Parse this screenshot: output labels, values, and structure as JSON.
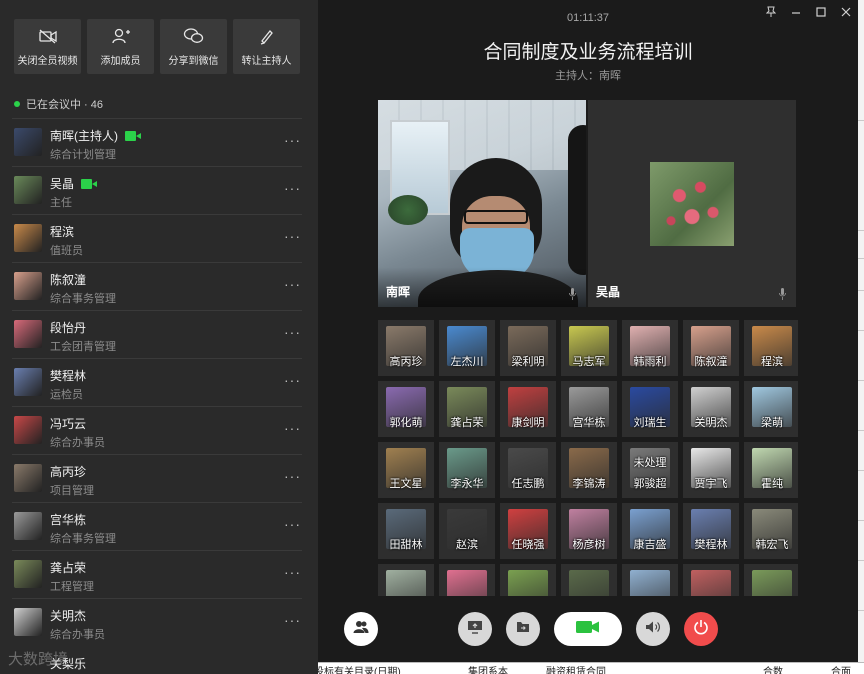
{
  "left_panel": {
    "actions": [
      {
        "label": "关闭全员视频",
        "icon": "video-off-icon"
      },
      {
        "label": "添加成员",
        "icon": "add-user-icon"
      },
      {
        "label": "分享到微信",
        "icon": "wechat-icon"
      },
      {
        "label": "转让主持人",
        "icon": "pen-icon"
      }
    ],
    "in_meeting_text": "已在会议中 · 46",
    "participants": [
      {
        "name": "南晖(主持人)",
        "role": "综合计划管理",
        "camera": true,
        "color": "#3b4a6b"
      },
      {
        "name": "吴晶",
        "role": "主任",
        "camera": true,
        "color": "#6a8a5a"
      },
      {
        "name": "程滨",
        "role": "值班员",
        "camera": false,
        "color": "#c98a4a"
      },
      {
        "name": "陈叙潼",
        "role": "综合事务管理",
        "camera": false,
        "color": "#d7a08c"
      },
      {
        "name": "段怡丹",
        "role": "工会团青管理",
        "camera": false,
        "color": "#d86a7a"
      },
      {
        "name": "樊程林",
        "role": "运检员",
        "camera": false,
        "color": "#6a7fb0"
      },
      {
        "name": "冯巧云",
        "role": "综合办事员",
        "camera": false,
        "color": "#c84848"
      },
      {
        "name": "高丙珍",
        "role": "项目管理",
        "camera": false,
        "color": "#8a7a6a"
      },
      {
        "name": "宫华栋",
        "role": "综合事务管理",
        "camera": false,
        "color": "#9a9a9a"
      },
      {
        "name": "龚占荣",
        "role": "工程管理",
        "camera": false,
        "color": "#7a8a5a"
      },
      {
        "name": "关明杰",
        "role": "综合办事员",
        "camera": false,
        "color": "#d0d0d0"
      }
    ],
    "partial_name": "关梨乐",
    "watermark": "大数跨境"
  },
  "meeting": {
    "timer": "01:11:37",
    "title": "合同制度及业务流程培训",
    "host": "主持人：南晖",
    "window_controls": [
      "pin-icon",
      "minimize-icon",
      "maximize-icon",
      "close-icon"
    ]
  },
  "video_tiles": [
    {
      "name": "南晖"
    },
    {
      "name": "吴晶"
    }
  ],
  "grid": [
    {
      "name": "高丙珍",
      "color": "#8a7a6a"
    },
    {
      "name": "左杰川",
      "color": "#4a8ad0"
    },
    {
      "name": "梁利明",
      "color": "#7a6a5a"
    },
    {
      "name": "马志军",
      "color": "#c8c850"
    },
    {
      "name": "韩雨利",
      "color": "#e0b0b0"
    },
    {
      "name": "陈叙潼",
      "color": "#d7a08c"
    },
    {
      "name": "程滨",
      "color": "#c98a4a"
    },
    {
      "name": "郭化萌",
      "color": "#8a6ab0"
    },
    {
      "name": "龚占荣",
      "color": "#7a8a5a"
    },
    {
      "name": "康剑明",
      "color": "#c04040"
    },
    {
      "name": "宫华栋",
      "color": "#9a9a9a"
    },
    {
      "name": "刘瑞生",
      "color": "#2a4aa0"
    },
    {
      "name": "关明杰",
      "color": "#d0d0d0"
    },
    {
      "name": "梁萌",
      "color": "#a0c8e0"
    },
    {
      "name": "王文星",
      "color": "#a08050"
    },
    {
      "name": "李永华",
      "color": "#6a9a8a"
    },
    {
      "name": "任志鹏",
      "color": "#4a4a4a"
    },
    {
      "name": "李锦涛",
      "color": "#8a6a4a"
    },
    {
      "name": "郭骏超",
      "color": "#7a7a7a",
      "status": "未处理"
    },
    {
      "name": "贾宇飞",
      "color": "#e8e8e8"
    },
    {
      "name": "霍纯",
      "color": "#c0d8b0"
    },
    {
      "name": "田甜林",
      "color": "#5a6a7a"
    },
    {
      "name": "赵滨",
      "color": "#3a3a3a"
    },
    {
      "name": "任晓强",
      "color": "#d04040"
    },
    {
      "name": "杨彦树",
      "color": "#c080a0"
    },
    {
      "name": "康吉盛",
      "color": "#7aa0d0"
    },
    {
      "name": "樊程林",
      "color": "#6a7fb0"
    },
    {
      "name": "韩宏飞",
      "color": "#8a8a7a"
    },
    {
      "name": "",
      "color": "#a0b0a0"
    },
    {
      "name": "",
      "color": "#e07090"
    },
    {
      "name": "",
      "color": "#7aa050"
    },
    {
      "name": "",
      "color": "#5a6a4a"
    },
    {
      "name": "",
      "color": "#90b0d0"
    },
    {
      "name": "",
      "color": "#c06060"
    },
    {
      "name": "",
      "color": "#7a9a5a"
    }
  ],
  "controls": [
    {
      "name": "members-button",
      "icon": "members-icon"
    },
    {
      "name": "share-screen-button",
      "icon": "share-screen-icon"
    },
    {
      "name": "share-file-button",
      "icon": "file-icon"
    },
    {
      "name": "video-button",
      "icon": "camera-icon",
      "color": "#2bc23f"
    },
    {
      "name": "speaker-button",
      "icon": "speaker-icon"
    },
    {
      "name": "hangup-button",
      "icon": "power-icon",
      "color": "#f14c4c"
    }
  ],
  "background_strip": [
    "投标有关目录(日期)",
    "集团系本",
    "融资租赁合同",
    "合数",
    "合面"
  ]
}
